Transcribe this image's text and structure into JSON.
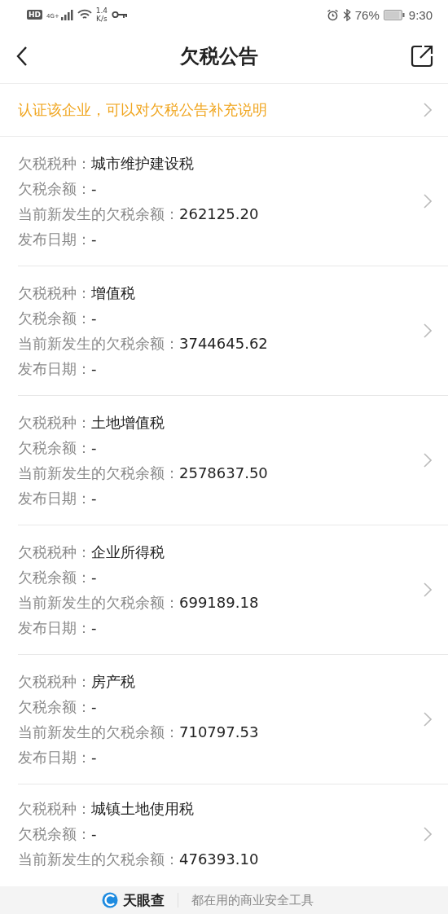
{
  "status_bar": {
    "hd": "HD",
    "network": "4G+",
    "speed": [
      "1.4",
      "K/s"
    ],
    "battery": "76%",
    "time": "9:30"
  },
  "header": {
    "title": "欠税公告"
  },
  "notice": {
    "text": "认证该企业，可以对欠税公告补充说明"
  },
  "items": [
    {
      "fields": [
        {
          "name": "欠税税种：",
          "text": "城市维护建设税"
        },
        {
          "name": "欠税余额：",
          "text": "-"
        },
        {
          "name": "当前新发生的欠税余额：",
          "text": "262125.20"
        },
        {
          "name": "发布日期：",
          "text": "-"
        }
      ]
    },
    {
      "fields": [
        {
          "name": "欠税税种：",
          "text": "增值税"
        },
        {
          "name": "欠税余额：",
          "text": "-"
        },
        {
          "name": "当前新发生的欠税余额：",
          "text": "3744645.62"
        },
        {
          "name": "发布日期：",
          "text": "-"
        }
      ]
    },
    {
      "fields": [
        {
          "name": "欠税税种：",
          "text": "土地增值税"
        },
        {
          "name": "欠税余额：",
          "text": "-"
        },
        {
          "name": "当前新发生的欠税余额：",
          "text": "2578637.50"
        },
        {
          "name": "发布日期：",
          "text": "-"
        }
      ]
    },
    {
      "fields": [
        {
          "name": "欠税税种：",
          "text": "企业所得税"
        },
        {
          "name": "欠税余额：",
          "text": "-"
        },
        {
          "name": "当前新发生的欠税余额：",
          "text": "699189.18"
        },
        {
          "name": "发布日期：",
          "text": "-"
        }
      ]
    },
    {
      "fields": [
        {
          "name": "欠税税种：",
          "text": "房产税"
        },
        {
          "name": "欠税余额：",
          "text": "-"
        },
        {
          "name": "当前新发生的欠税余额：",
          "text": "710797.53"
        },
        {
          "name": "发布日期：",
          "text": "-"
        }
      ]
    },
    {
      "fields": [
        {
          "name": "欠税税种：",
          "text": "城镇土地使用税"
        },
        {
          "name": "欠税余额：",
          "text": "-"
        },
        {
          "name": "当前新发生的欠税余额：",
          "text": "476393.10"
        }
      ]
    }
  ],
  "banner": {
    "brand": "天眼查",
    "slogan": "都在用的商业安全工具"
  }
}
